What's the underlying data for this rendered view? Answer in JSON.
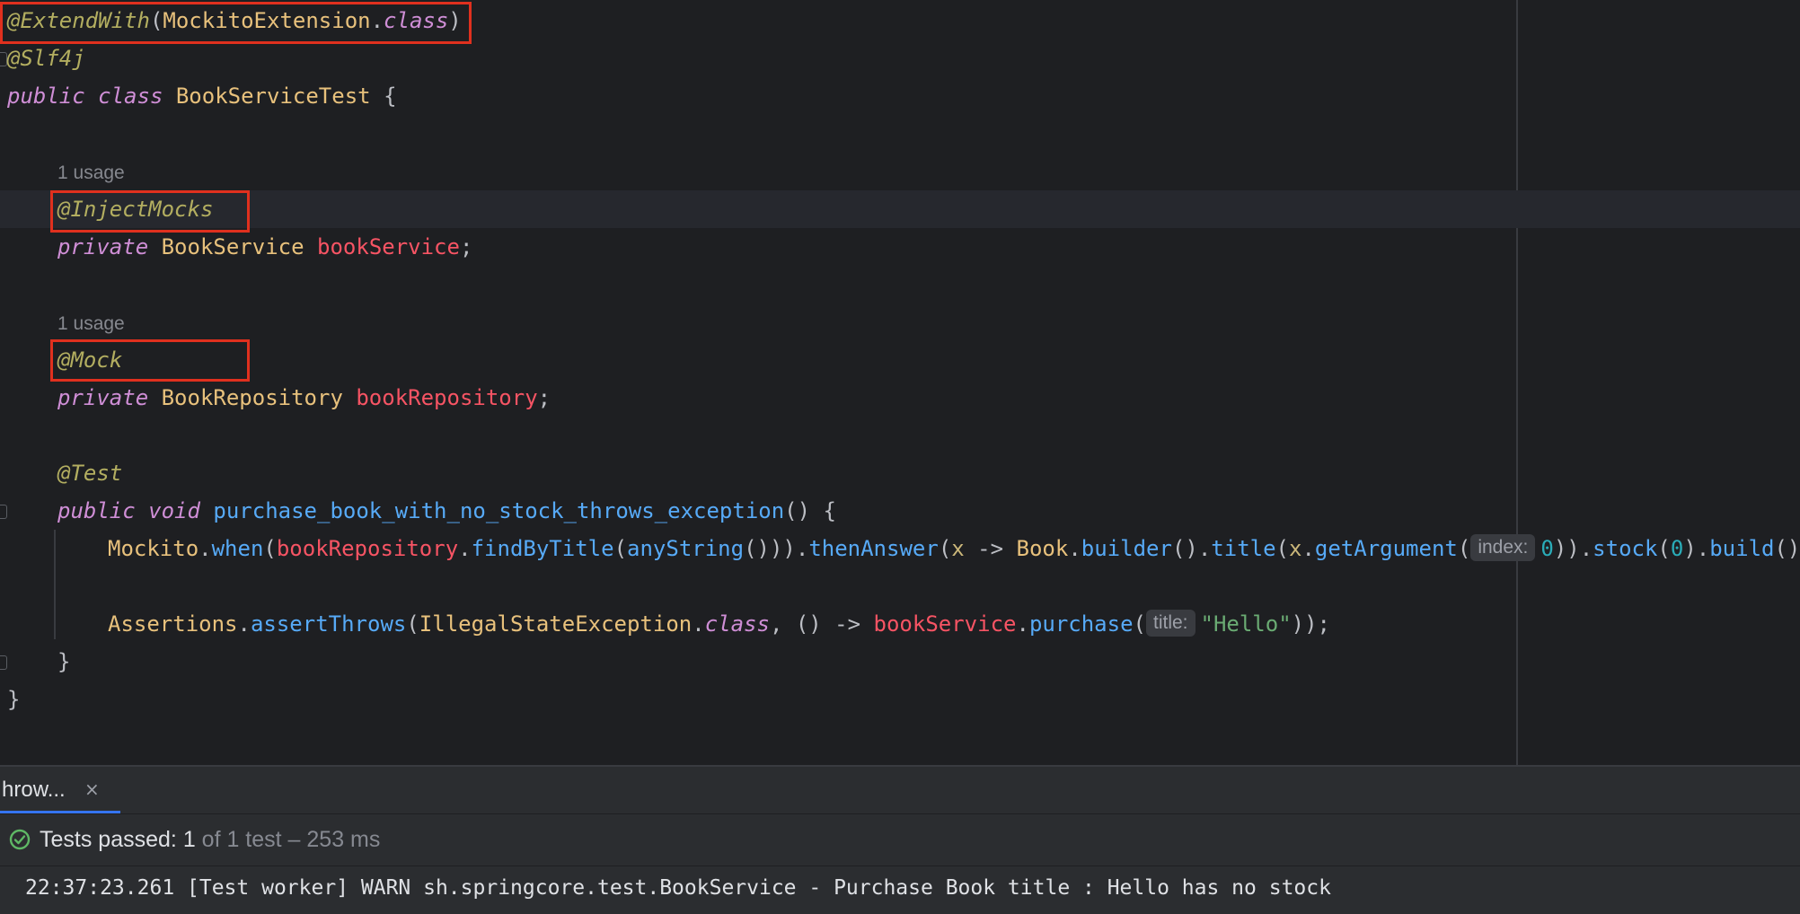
{
  "editor": {
    "usage_hint_1": "1 usage",
    "usage_hint_2": "1 usage",
    "line1": {
      "ann": "@ExtendWith",
      "open": "(",
      "cls": "MockitoExtension",
      "dot": ".",
      "kw": "class",
      "close": ")"
    },
    "line2": {
      "ann": "@Slf4j"
    },
    "line3": {
      "kw1": "public",
      "kw2": "class",
      "cls": "BookServiceTest",
      "brace": "{"
    },
    "line4": {
      "ann": "@InjectMocks"
    },
    "line5": {
      "kw": "private",
      "type": "BookService",
      "field": "bookService",
      "semi": ";"
    },
    "line6": {
      "ann": "@Mock"
    },
    "line7": {
      "kw": "private",
      "type": "BookRepository",
      "field": "bookRepository",
      "semi": ";"
    },
    "line8": {
      "ann": "@Test"
    },
    "line9": {
      "kw1": "public",
      "kw2": "void",
      "method": "purchase_book_with_no_stock_throws_exception",
      "rest": "() {"
    },
    "line10": {
      "cls": "Mockito",
      "when": "when",
      "field": "bookRepository",
      "find": "findByTitle",
      "any": "anyString",
      "then": "thenAnswer",
      "param": "x",
      "arrow": "->",
      "book": "Book",
      "builder": "builder",
      "title": "title",
      "getArg": "getArgument",
      "hint": "index:",
      "zero1": "0",
      "stock": "stock",
      "zero2": "0",
      "build": "build"
    },
    "line11": {
      "cls": "Assertions",
      "method": "assertThrows",
      "exc": "IllegalStateException",
      "kw": "class",
      "field": "bookService",
      "purchase": "purchase",
      "hint": "title:",
      "str": "\"Hello\""
    },
    "line12": {
      "brace": "}"
    },
    "line13": {
      "brace": "}"
    }
  },
  "run_panel": {
    "tab_label": "hrow...",
    "tab_close": "×",
    "status_prefix": "Tests passed: ",
    "status_count": "1",
    "status_total": " of 1 test",
    "status_time": " – 253 ms",
    "console_line": "22:37:23.261 [Test worker] WARN sh.springcore.test.BookService - Purchase Book title : Hello has no stock"
  },
  "colors": {
    "background": "#1e1f22",
    "highlight_box": "#e0301e",
    "success": "#5fb865",
    "tab_accent": "#3574f0"
  }
}
